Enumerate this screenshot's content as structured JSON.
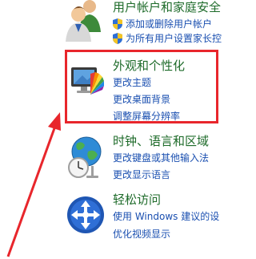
{
  "sections": {
    "user_accounts": {
      "title": "用户帐户和家庭安全",
      "links": [
        "添加或删除用户帐户",
        "为所有用户设置家长控"
      ]
    },
    "appearance": {
      "title": "外观和个性化",
      "links": [
        "更改主题",
        "更改桌面背景",
        "调整屏幕分辨率"
      ]
    },
    "clock_language": {
      "title": "时钟、语言和区域",
      "links": [
        "更改键盘或其他输入法",
        "更改显示语言"
      ]
    },
    "ease_of_access": {
      "title": "轻松访问",
      "links": [
        "使用 Windows 建议的设",
        "优化视频显示"
      ]
    }
  },
  "icons": {
    "user_accounts": "users-icon",
    "appearance": "monitor-palette-icon",
    "clock_language": "globe-clock-icon",
    "ease_of_access": "accessibility-icon",
    "shield": "uac-shield-icon"
  },
  "colors": {
    "title": "#1e6b2a",
    "link": "#1a4fb0",
    "annotation": "#e8262c"
  }
}
